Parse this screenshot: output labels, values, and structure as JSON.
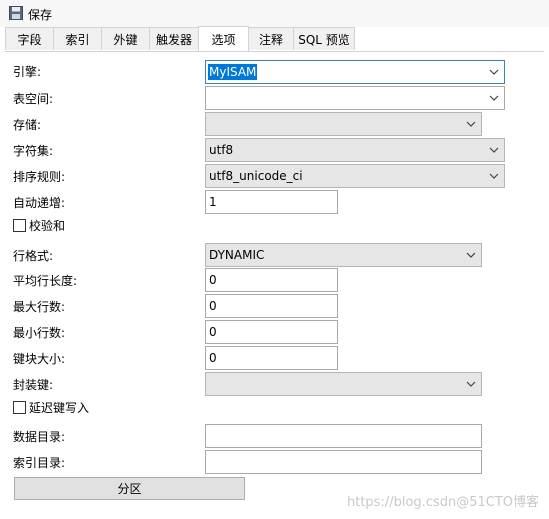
{
  "toolbar": {
    "save_label": "保存"
  },
  "tabs": [
    {
      "label": "字段"
    },
    {
      "label": "索引"
    },
    {
      "label": "外键"
    },
    {
      "label": "触发器"
    },
    {
      "label": "选项",
      "active": true
    },
    {
      "label": "注释"
    },
    {
      "label": "SQL 预览"
    }
  ],
  "options": {
    "engine": {
      "label": "引擎:",
      "value": "MyISAM"
    },
    "tablespace": {
      "label": "表空间:",
      "value": ""
    },
    "storage": {
      "label": "存储:",
      "value": ""
    },
    "charset": {
      "label": "字符集:",
      "value": "utf8"
    },
    "collation": {
      "label": "排序规则:",
      "value": "utf8_unicode_ci"
    },
    "auto_increment": {
      "label": "自动递增:",
      "value": "1"
    },
    "checksum": {
      "label": "校验和",
      "checked": false
    },
    "row_format": {
      "label": "行格式:",
      "value": "DYNAMIC"
    },
    "avg_row_length": {
      "label": "平均行长度:",
      "value": "0"
    },
    "max_rows": {
      "label": "最大行数:",
      "value": "0"
    },
    "min_rows": {
      "label": "最小行数:",
      "value": "0"
    },
    "key_block_size": {
      "label": "键块大小:",
      "value": "0"
    },
    "pack_keys": {
      "label": "封装键:",
      "value": ""
    },
    "delay_key_write": {
      "label": "延迟键写入",
      "checked": false
    },
    "data_directory": {
      "label": "数据目录:",
      "value": ""
    },
    "index_directory": {
      "label": "索引目录:",
      "value": ""
    }
  },
  "partition_button": "分区",
  "watermark": "https://blog.csdn@51CTO博客"
}
